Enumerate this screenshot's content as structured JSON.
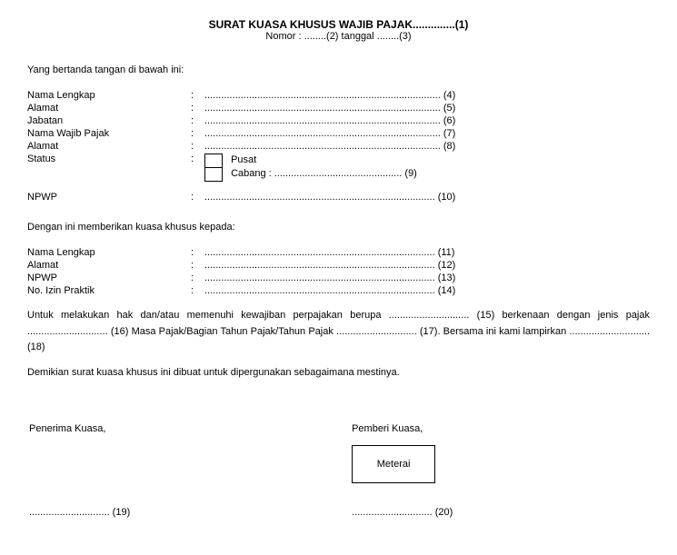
{
  "title": "SURAT KUASA KHUSUS WAJIB PAJAK..............(1)",
  "subtitle": "Nomor : ........(2) tanggal ........(3)",
  "intro": "Yang bertanda tangan di bawah ini:",
  "grantor": {
    "fields": [
      {
        "label": "Nama Lengkap",
        "value": "..................................................................................... (4)"
      },
      {
        "label": "Alamat",
        "value": "..................................................................................... (5)"
      },
      {
        "label": "Jabatan",
        "value": "..................................................................................... (6)"
      },
      {
        "label": "Nama Wajib Pajak",
        "value": "..................................................................................... (7)"
      },
      {
        "label": "Alamat",
        "value": "..................................................................................... (8)"
      }
    ],
    "status_label": "Status",
    "status_pusat": "Pusat",
    "status_cabang": "Cabang : .............................................. (9)",
    "npwp_label": "NPWP",
    "npwp_value": "................................................................................... (10)"
  },
  "grant_text": "Dengan ini memberikan kuasa khusus kepada:",
  "grantee": {
    "fields": [
      {
        "label": "Nama Lengkap",
        "value": "................................................................................... (11)"
      },
      {
        "label": "Alamat",
        "value": "................................................................................... (12)"
      },
      {
        "label": "NPWP",
        "value": "................................................................................... (13)"
      },
      {
        "label": "No. Izin Praktik",
        "value": "................................................................................... (14)"
      }
    ]
  },
  "body_para": "Untuk melakukan hak dan/atau memenuhi kewajiban perpajakan berupa ............................. (15) berkenaan dengan jenis pajak ............................. (16) Masa Pajak/Bagian Tahun Pajak/Tahun Pajak ............................. (17). Bersama ini kami lampirkan ............................. (18)",
  "closing": "Demikian surat kuasa khusus ini dibuat untuk dipergunakan sebagaimana mestinya.",
  "sig": {
    "receiver_title": "Penerima Kuasa,",
    "giver_title": "Pemberi Kuasa,",
    "meterai": "Meterai",
    "receiver_line": "............................. (19)",
    "giver_line": "............................. (20)"
  }
}
